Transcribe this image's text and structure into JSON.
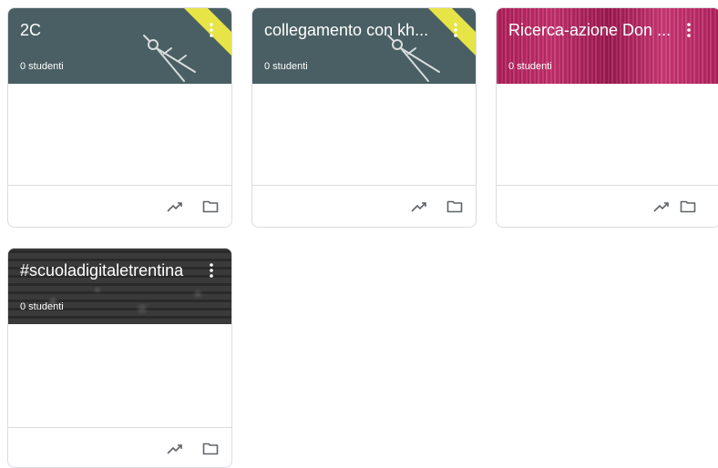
{
  "cards": [
    {
      "title": "2C",
      "subtitle": "0 studenti",
      "theme": "slate-compass",
      "header_color": "#4a5f63",
      "icons": [
        "more-vert-icon",
        "trending-up-icon",
        "folder-icon"
      ]
    },
    {
      "title": "collegamento con kh...",
      "subtitle": "0 studenti",
      "theme": "slate-compass",
      "header_color": "#4a5f63",
      "icons": [
        "more-vert-icon",
        "trending-up-icon",
        "folder-icon"
      ]
    },
    {
      "title": "Ricerca-azione Don ...",
      "subtitle": "0 studenti",
      "theme": "pink-textile",
      "header_color": "#b3205c",
      "icons": [
        "more-vert-icon",
        "trending-up-icon",
        "folder-icon"
      ]
    },
    {
      "title": "#scuoladigitaletrentina",
      "subtitle": "0 studenti",
      "theme": "cobblestone",
      "header_color": "#3a3a3a",
      "icons": [
        "more-vert-icon",
        "trending-up-icon",
        "folder-icon"
      ]
    }
  ],
  "colors": {
    "card_border": "#dadce0",
    "icon_gray": "#5f6368",
    "accent_yellow": "#e7e447"
  }
}
